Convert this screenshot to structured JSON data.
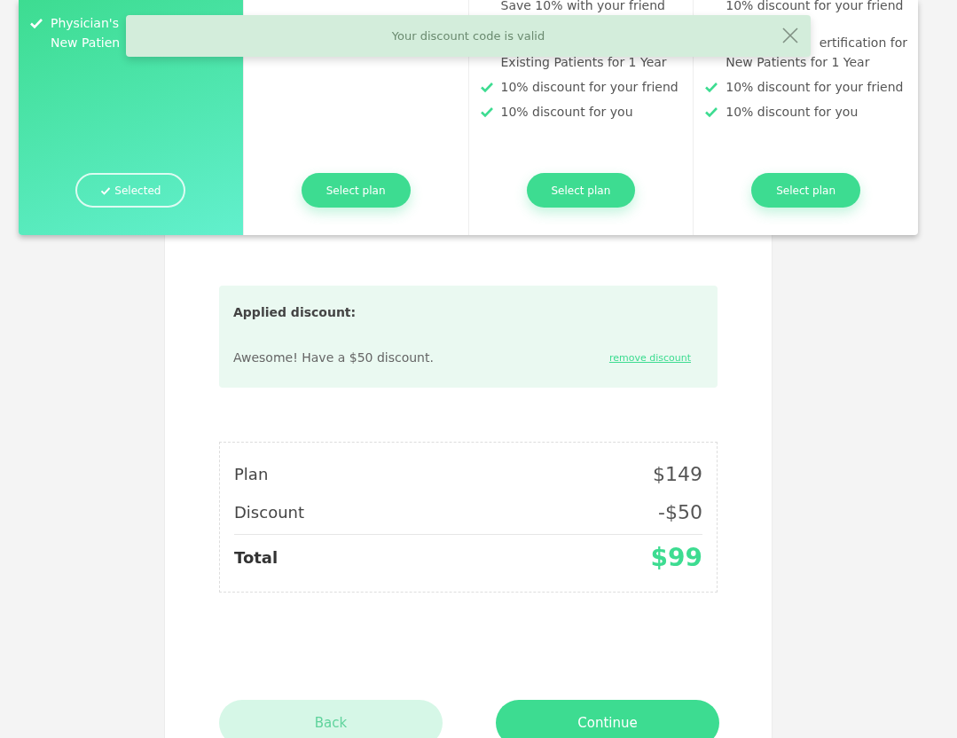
{
  "toast": {
    "message": "Your discount code is valid"
  },
  "plans": [
    {
      "selected": true,
      "button": "Selected",
      "top_features": [
        {
          "text": "Physician's New Patien",
          "check": true
        }
      ]
    },
    {
      "selected": false,
      "button": "Select plan"
    },
    {
      "selected": false,
      "button": "Select plan",
      "top_features": [
        {
          "text": "Save 10% with your friend",
          "check": false
        }
      ],
      "features": [
        {
          "text": "Existing Patients for 1 Year",
          "check": false
        },
        {
          "text": "10% discount for your friend",
          "check": true
        },
        {
          "text": "10% discount for you",
          "check": true
        }
      ]
    },
    {
      "selected": false,
      "button": "Select plan",
      "top_features": [
        {
          "text": "10% discount for your friend",
          "check": false
        },
        {
          "text": "ertification for",
          "check": false
        }
      ],
      "features": [
        {
          "text": "New Patients for 1 Year",
          "check": false
        },
        {
          "text": "10% discount for your friend",
          "check": true
        },
        {
          "text": "10% discount for you",
          "check": true
        }
      ]
    }
  ],
  "discount": {
    "title": "Applied discount:",
    "message": "Awesome! Have a $50 discount.",
    "remove_link": "remove discount"
  },
  "summary": [
    {
      "kind": "line",
      "label": "Plan",
      "amount": "$149"
    },
    {
      "kind": "line",
      "label": "Discount",
      "amount": "-$50"
    },
    {
      "kind": "total",
      "label": "Total",
      "amount": "$99"
    }
  ],
  "buttons": [
    {
      "kind": "secondary",
      "label": "Back"
    },
    {
      "kind": "primary",
      "label": "Continue"
    }
  ]
}
